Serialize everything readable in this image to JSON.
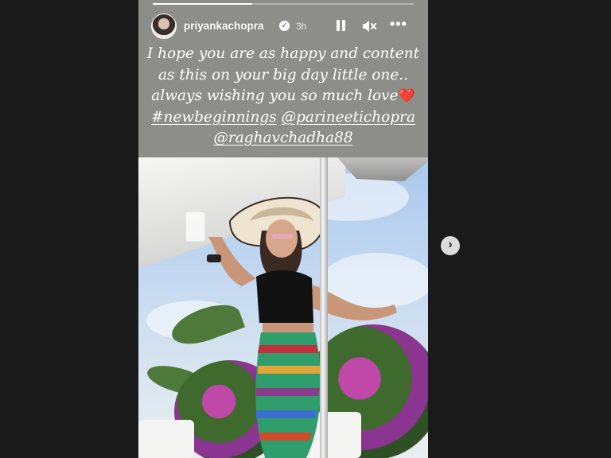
{
  "story": {
    "progress": 0.38,
    "user": {
      "username": "priyankachopra",
      "verified": true,
      "time_ago": "3h"
    },
    "controls": {
      "pause": "pause-icon",
      "mute": "muted-speaker-icon",
      "more": "more-options-icon"
    },
    "caption": {
      "line1": "I hope you are as happy and content",
      "line2": "as this on your big day little one..",
      "line3": "always wishing you so much love",
      "heart": "❤️",
      "hashtag": "#newbeginnings",
      "mention1": "@parineetichopra",
      "mention2": "@raghavchadha88"
    }
  },
  "navigation": {
    "next_icon": "chevron-right-icon",
    "next_glyph": "›"
  },
  "colors": {
    "story_header_bg": "#8d8d8a",
    "page_bg": "#1a1a1a",
    "heart": "#e53935"
  }
}
